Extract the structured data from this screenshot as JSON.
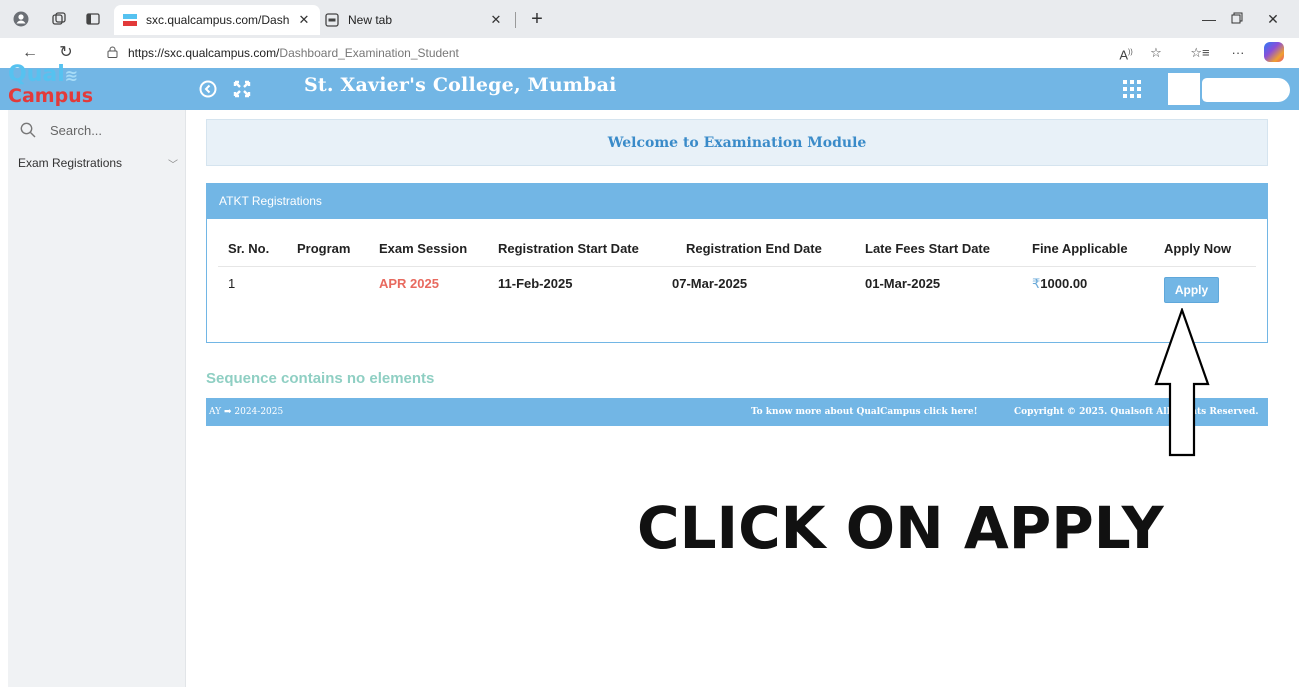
{
  "browser": {
    "tabs": [
      {
        "title": "sxc.qualcampus.com/Dashboard_",
        "active": true
      },
      {
        "title": "New tab",
        "active": false
      }
    ],
    "url_host": "https://sxc.qualcampus.com/",
    "url_path": "Dashboard_Examination_Student"
  },
  "header": {
    "logo_top": "Qual",
    "logo_bottom": "Campus",
    "college_name": "St. Xavier's College, Mumbai"
  },
  "sidebar": {
    "search_placeholder": "Search...",
    "items": [
      {
        "label": "Exam Registrations"
      }
    ]
  },
  "main": {
    "welcome": "Welcome to Examination Module",
    "panel_title": "ATKT Registrations",
    "columns": [
      "Sr. No.",
      "Program",
      "Exam Session",
      "Registration Start Date",
      "Registration End Date",
      "Late Fees Start Date",
      "Fine Applicable",
      "Apply Now"
    ],
    "rows": [
      {
        "sr_no": "1",
        "program": "",
        "exam_session": "APR 2025",
        "reg_start": "11-Feb-2025",
        "reg_end": "07-Mar-2025",
        "late_fees_start": "01-Mar-2025",
        "fine_currency": "₹",
        "fine": "1000.00",
        "apply_label": "Apply"
      }
    ],
    "error_message": "Sequence contains no elements"
  },
  "footer": {
    "ay_label": "AY",
    "ay_value": "2024-2025",
    "more_link": "To know more about QualCampus click here!",
    "copyright": "Copyright © 2025. Qualsoft All Rights Reserved."
  },
  "annotation": {
    "text": "CLICK ON APPLY"
  },
  "colors": {
    "header_blue": "#72b6e5",
    "session_red": "#e86a5f",
    "error_teal": "#8fcfc3"
  }
}
